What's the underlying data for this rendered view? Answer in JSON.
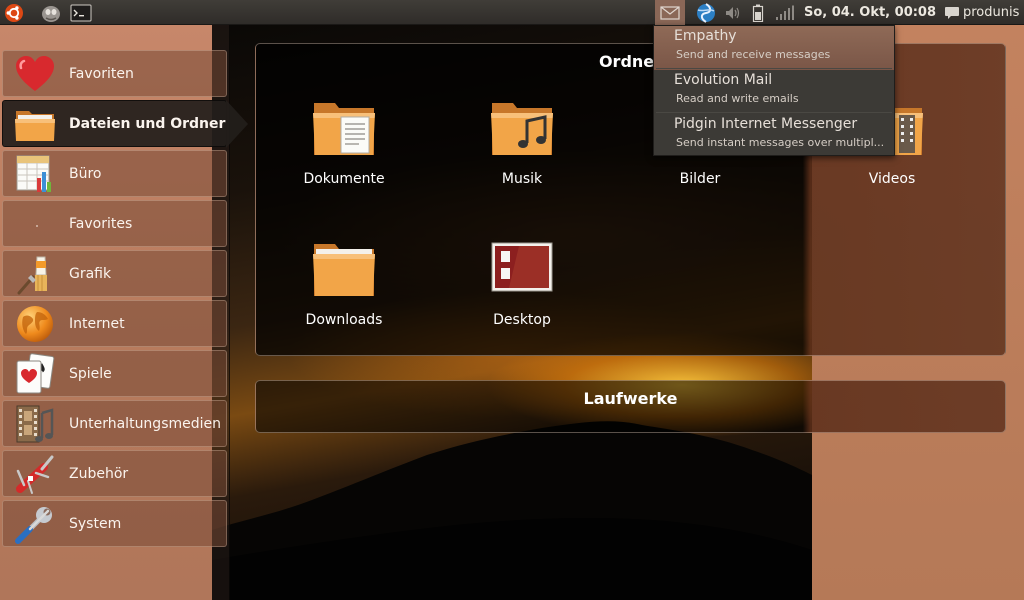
{
  "top_panel": {
    "icons": [
      "ubuntu-logo-icon",
      "gnome-face-icon",
      "terminal-icon",
      "mail-icon",
      "network-icon",
      "volume-icon",
      "battery-icon",
      "signal-icon",
      "chat-icon"
    ],
    "clock": "So, 04. Okt, 00:08",
    "user": "produnis"
  },
  "sidebar": {
    "items": [
      {
        "label": "Favoriten",
        "icon": "heart-icon"
      },
      {
        "label": "Dateien und Ordner",
        "icon": "folder-icon",
        "active": true
      },
      {
        "label": "Büro",
        "icon": "spreadsheet-icon"
      },
      {
        "label": "Favorites",
        "icon": "dot-icon"
      },
      {
        "label": "Grafik",
        "icon": "paintbrush-icon"
      },
      {
        "label": "Internet",
        "icon": "globe-icon"
      },
      {
        "label": "Spiele",
        "icon": "playing-cards-icon"
      },
      {
        "label": "Unterhaltungsmedien",
        "icon": "film-music-icon"
      },
      {
        "label": "Zubehör",
        "icon": "swiss-knife-icon"
      },
      {
        "label": "System",
        "icon": "screwdriver-wrench-icon"
      }
    ]
  },
  "ordner": {
    "title": "Ordner",
    "folders": [
      {
        "label": "Dokumente",
        "icon": "folder-documents-icon"
      },
      {
        "label": "Musik",
        "icon": "folder-music-icon"
      },
      {
        "label": "Bilder",
        "icon": "folder-pictures-icon"
      },
      {
        "label": "Videos",
        "icon": "folder-videos-icon"
      },
      {
        "label": "Downloads",
        "icon": "folder-downloads-icon"
      },
      {
        "label": "Desktop",
        "icon": "desktop-icon"
      }
    ]
  },
  "laufwerke": {
    "title": "Laufwerke"
  },
  "messaging_menu": {
    "items": [
      {
        "title": "Empathy",
        "subtitle": "Send and receive messages"
      },
      {
        "title": "Evolution Mail",
        "subtitle": "Read and write emails"
      },
      {
        "title": "Pidgin Internet Messenger",
        "subtitle": "Send instant messages over multipl..."
      }
    ]
  },
  "colors": {
    "panel_bg": "#2f2c29",
    "sidebar_active": "#231e1b",
    "menu_highlight": "#8f6a57",
    "folder_orange": "#f0a04a"
  }
}
